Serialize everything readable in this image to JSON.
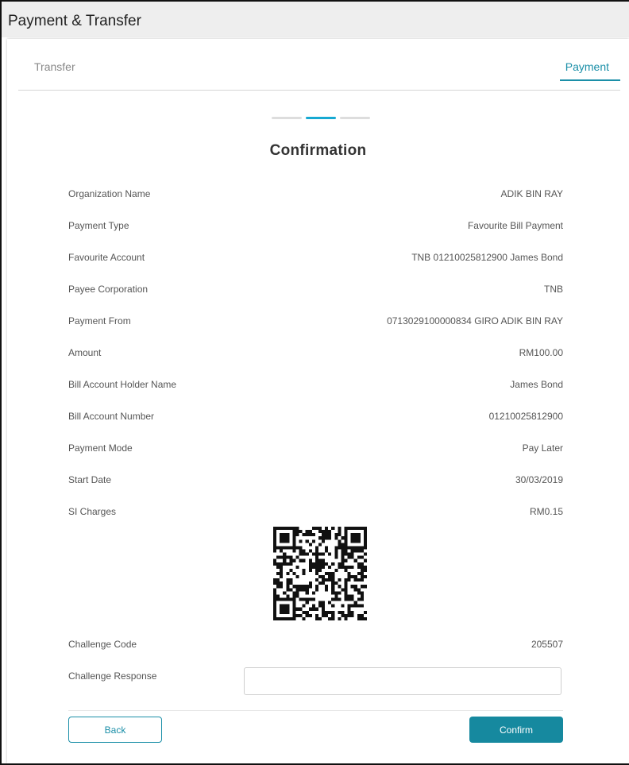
{
  "window": {
    "title": "Payment & Transfer"
  },
  "tabs": {
    "transfer": "Transfer",
    "payment": "Payment"
  },
  "page": {
    "heading": "Confirmation"
  },
  "details": [
    {
      "label": "Organization Name",
      "value": "ADIK BIN RAY"
    },
    {
      "label": "Payment Type",
      "value": "Favourite Bill Payment"
    },
    {
      "label": "Favourite Account",
      "value": "TNB 01210025812900 James Bond"
    },
    {
      "label": "Payee Corporation",
      "value": "TNB"
    },
    {
      "label": "Payment From",
      "value": "0713029100000834 GIRO ADIK BIN RAY"
    },
    {
      "label": "Amount",
      "value": "RM100.00"
    },
    {
      "label": "Bill Account Holder Name",
      "value": "James Bond"
    },
    {
      "label": "Bill Account Number",
      "value": "01210025812900"
    },
    {
      "label": "Payment Mode",
      "value": "Pay Later"
    },
    {
      "label": "Start Date",
      "value": "30/03/2019"
    },
    {
      "label": "SI Charges",
      "value": "RM0.15"
    }
  ],
  "challenge": {
    "code_label": "Challenge Code",
    "code_value": "205507",
    "response_label": "Challenge Response",
    "response_value": "",
    "response_placeholder": ""
  },
  "buttons": {
    "back": "Back",
    "confirm": "Confirm"
  },
  "qr": {
    "icon": "qr-code-icon"
  },
  "colors": {
    "accent": "#1b8fa8",
    "stepper_active": "#17a9d2",
    "confirm_bg": "#16899f"
  }
}
